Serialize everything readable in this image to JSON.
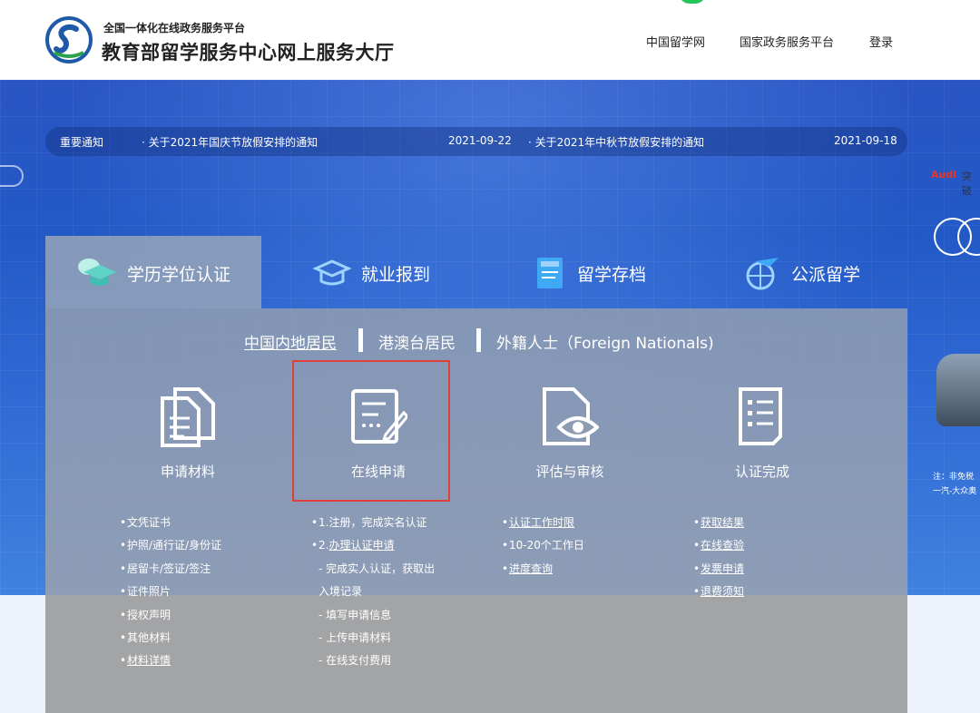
{
  "header": {
    "brand_small": "全国一体化在线政务服务平台",
    "brand_big": "教育部留学服务中心网上服务大厅",
    "nav": [
      "中国留学网",
      "国家政务服务平台",
      "登录"
    ]
  },
  "notices": {
    "label": "重要通知",
    "items": [
      {
        "title": "· 关于2021年国庆节放假安排的通知",
        "date": "2021-09-22"
      },
      {
        "title": "· 关于2021年中秋节放假安排的通知",
        "date": "2021-09-18"
      }
    ]
  },
  "side": {
    "audi": "Audi",
    "audi_text": "突破",
    "note1": "注：非免税",
    "note2": "一汽-大众奥"
  },
  "tabs": [
    {
      "label": "学历学位认证",
      "icon": "graduation-cap-icon",
      "active": true
    },
    {
      "label": "就业报到",
      "icon": "hat-icon",
      "active": false
    },
    {
      "label": "留学存档",
      "icon": "archive-doc-icon",
      "active": false
    },
    {
      "label": "公派留学",
      "icon": "plane-globe-icon",
      "active": false
    }
  ],
  "subtabs": [
    "中国内地居民",
    "港澳台居民",
    "外籍人士（Foreign Nationals)"
  ],
  "steps": [
    {
      "label": "申请材料",
      "icon": "documents-icon"
    },
    {
      "label": "在线申请",
      "icon": "edit-form-icon"
    },
    {
      "label": "评估与审核",
      "icon": "review-eye-icon"
    },
    {
      "label": "认证完成",
      "icon": "checklist-icon"
    }
  ],
  "columns": [
    [
      {
        "text": "文凭证书",
        "link": false,
        "bullet": true
      },
      {
        "text": "护照/通行证/身份证",
        "link": false,
        "bullet": true
      },
      {
        "text": "居留卡/签证/签注",
        "link": false,
        "bullet": true
      },
      {
        "text": "证件照片",
        "link": false,
        "bullet": true
      },
      {
        "text": "授权声明",
        "link": false,
        "bullet": true
      },
      {
        "text": "其他材料",
        "link": false,
        "bullet": true
      },
      {
        "text": "材料详情",
        "link": true,
        "bullet": true
      }
    ],
    [
      {
        "text": "1.注册，完成实名认证",
        "link": false,
        "bullet": true
      },
      {
        "prefix": "2.",
        "text": "办理认证申请",
        "link": true,
        "bullet": true
      },
      {
        "text": "- 完成实人认证，获取出",
        "link": false,
        "bullet": false
      },
      {
        "text": "入境记录",
        "link": false,
        "bullet": false
      },
      {
        "text": "- 填写申请信息",
        "link": false,
        "bullet": false
      },
      {
        "text": "- 上传申请材料",
        "link": false,
        "bullet": false
      },
      {
        "text": "- 在线支付费用",
        "link": false,
        "bullet": false
      }
    ],
    [
      {
        "text": "认证工作时限",
        "link": true,
        "bullet": true
      },
      {
        "text": "10-20个工作日",
        "link": false,
        "bullet": true
      },
      {
        "text": "进度查询",
        "link": true,
        "bullet": true
      }
    ],
    [
      {
        "text": "获取结果",
        "link": true,
        "bullet": true
      },
      {
        "text": "在线查验",
        "link": true,
        "bullet": true
      },
      {
        "text": "发票申请",
        "link": true,
        "bullet": true
      },
      {
        "text": "退费须知",
        "link": true,
        "bullet": true
      }
    ]
  ]
}
